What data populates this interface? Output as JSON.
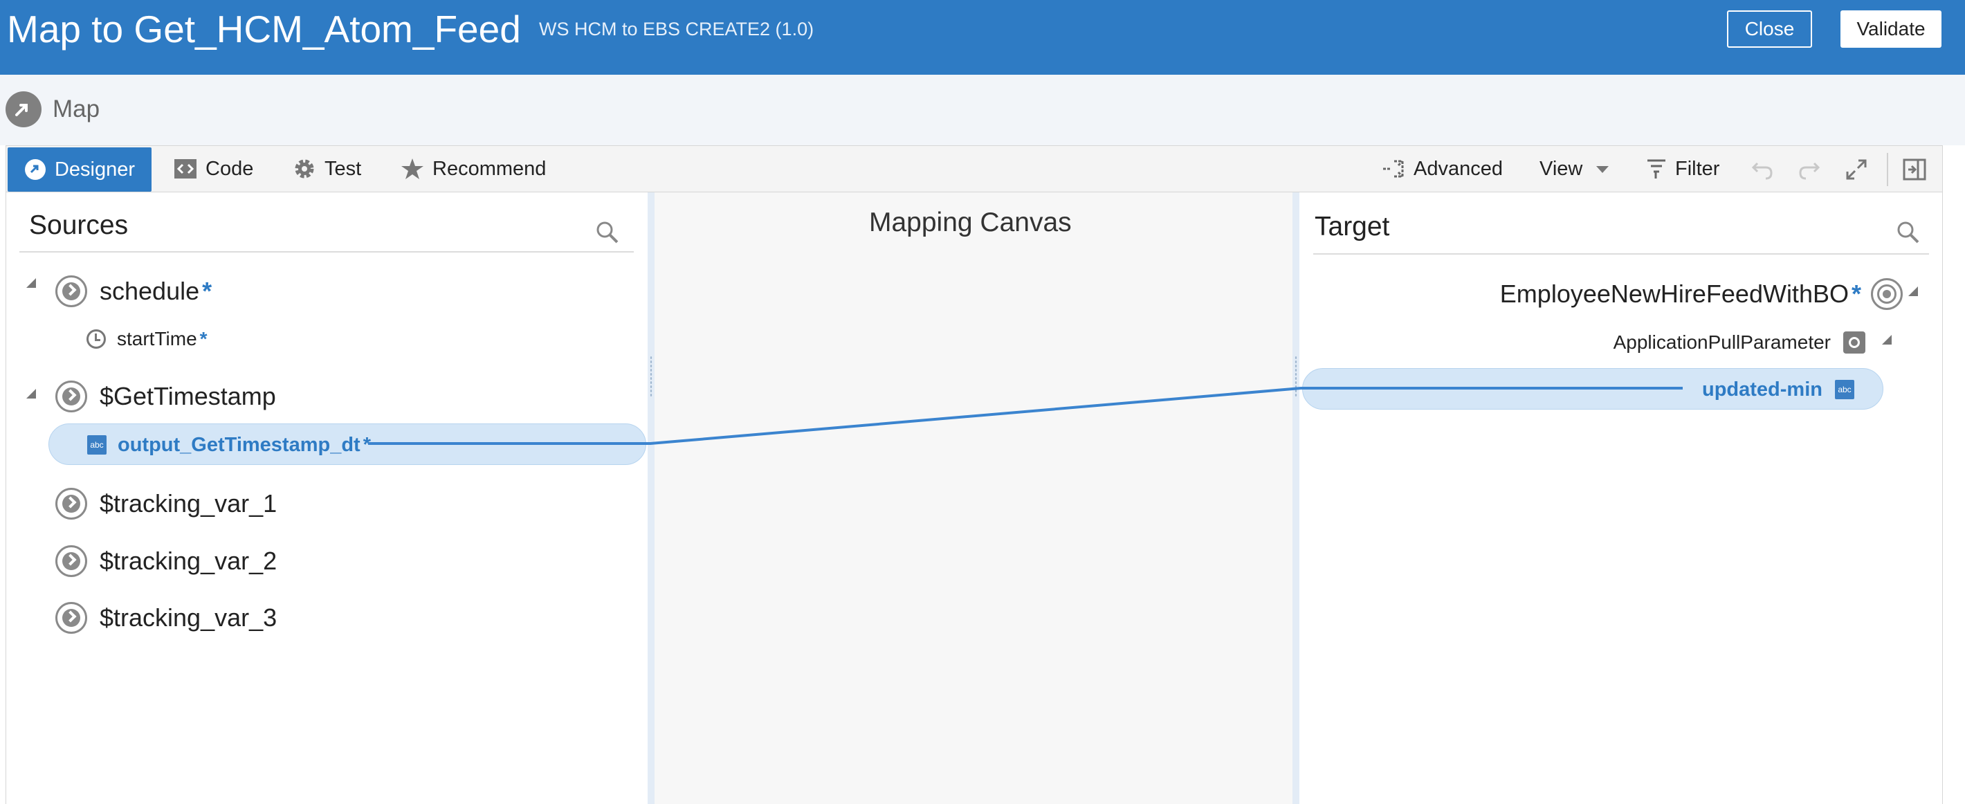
{
  "header": {
    "title": "Map to Get_HCM_Atom_Feed",
    "subtitle": "WS HCM to EBS CREATE2 (1.0)",
    "close_label": "Close",
    "validate_label": "Validate",
    "bg_color": "#2e7bc4"
  },
  "page": {
    "map_label": "Map"
  },
  "toolbar": {
    "tabs": [
      {
        "label": "Designer",
        "icon": "designer-icon",
        "active": true
      },
      {
        "label": "Code",
        "icon": "code-icon"
      },
      {
        "label": "Test",
        "icon": "gear-icon"
      },
      {
        "label": "Recommend",
        "icon": "star-icon"
      }
    ],
    "advanced_label": "Advanced",
    "view_label": "View",
    "filter_label": "Filter"
  },
  "sources": {
    "title": "Sources",
    "items": [
      {
        "label": "schedule",
        "required": "*",
        "icon": "circle-chevron-icon",
        "expanded": true
      },
      {
        "label": "startTime",
        "required": "*",
        "icon": "clock-icon"
      },
      {
        "label": "$GetTimestamp",
        "icon": "circle-chevron-icon",
        "expanded": true
      },
      {
        "label": "output_GetTimestamp_dt",
        "required": "*",
        "icon": "abc-icon",
        "mapped": true
      },
      {
        "label": "$tracking_var_1",
        "icon": "circle-chevron-icon"
      },
      {
        "label": "$tracking_var_2",
        "icon": "circle-chevron-icon"
      },
      {
        "label": "$tracking_var_3",
        "icon": "circle-chevron-icon"
      }
    ]
  },
  "canvas": {
    "title": "Mapping Canvas"
  },
  "target": {
    "title": "Target",
    "items": [
      {
        "label": "EmployeeNewHireFeedWithBO",
        "required": "*",
        "icon": "target-icon"
      },
      {
        "label": "ApplicationPullParameter",
        "icon": "square-target-icon"
      },
      {
        "label": "updated-min",
        "icon": "abc-icon",
        "mapped": true
      }
    ]
  },
  "abc_text": "abc"
}
